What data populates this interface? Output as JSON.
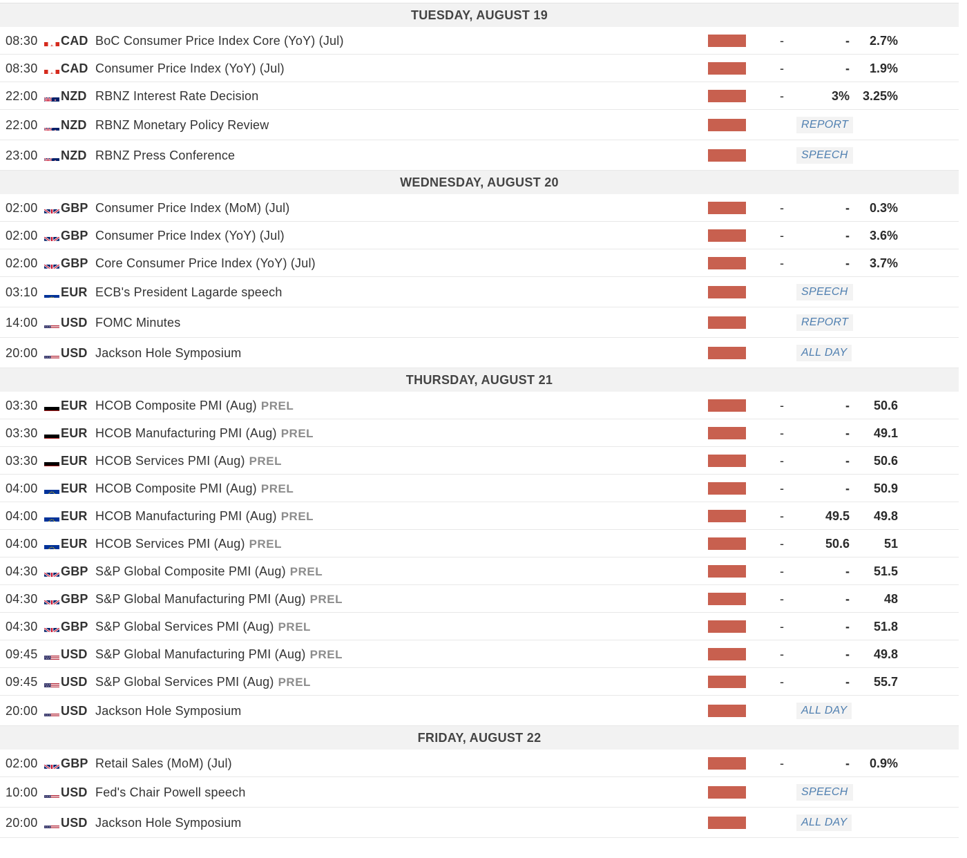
{
  "days": [
    {
      "label": "TUESDAY, AUGUST 19",
      "events": [
        {
          "time": "08:30",
          "flag": "ca",
          "currency": "CAD",
          "name": "BoC Consumer Price Index Core (YoY) (Jul)",
          "actual": "-",
          "consensus": "-",
          "previous": "2.7%"
        },
        {
          "time": "08:30",
          "flag": "ca",
          "currency": "CAD",
          "name": "Consumer Price Index (YoY) (Jul)",
          "actual": "-",
          "consensus": "-",
          "previous": "1.9%"
        },
        {
          "time": "22:00",
          "flag": "nz",
          "currency": "NZD",
          "name": "RBNZ Interest Rate Decision",
          "actual": "-",
          "consensus": "3%",
          "previous": "3.25%"
        },
        {
          "time": "22:00",
          "flag": "nz",
          "currency": "NZD",
          "name": "RBNZ Monetary Policy Review",
          "tag": "REPORT"
        },
        {
          "time": "23:00",
          "flag": "nz",
          "currency": "NZD",
          "name": "RBNZ Press Conference",
          "tag": "SPEECH"
        }
      ]
    },
    {
      "label": "WEDNESDAY, AUGUST 20",
      "events": [
        {
          "time": "02:00",
          "flag": "gb",
          "currency": "GBP",
          "name": "Consumer Price Index (MoM) (Jul)",
          "actual": "-",
          "consensus": "-",
          "previous": "0.3%"
        },
        {
          "time": "02:00",
          "flag": "gb",
          "currency": "GBP",
          "name": "Consumer Price Index (YoY) (Jul)",
          "actual": "-",
          "consensus": "-",
          "previous": "3.6%"
        },
        {
          "time": "02:00",
          "flag": "gb",
          "currency": "GBP",
          "name": "Core Consumer Price Index (YoY) (Jul)",
          "actual": "-",
          "consensus": "-",
          "previous": "3.7%"
        },
        {
          "time": "03:10",
          "flag": "eu",
          "currency": "EUR",
          "name": "ECB's President Lagarde speech",
          "tag": "SPEECH"
        },
        {
          "time": "14:00",
          "flag": "us",
          "currency": "USD",
          "name": "FOMC Minutes",
          "tag": "REPORT"
        },
        {
          "time": "20:00",
          "flag": "us",
          "currency": "USD",
          "name": "Jackson Hole Symposium",
          "tag": "ALL DAY"
        }
      ]
    },
    {
      "label": "THURSDAY, AUGUST 21",
      "events": [
        {
          "time": "03:30",
          "flag": "de",
          "currency": "EUR",
          "name": "HCOB Composite PMI (Aug)",
          "prel": "PREL",
          "actual": "-",
          "consensus": "-",
          "previous": "50.6"
        },
        {
          "time": "03:30",
          "flag": "de",
          "currency": "EUR",
          "name": "HCOB Manufacturing PMI (Aug)",
          "prel": "PREL",
          "actual": "-",
          "consensus": "-",
          "previous": "49.1"
        },
        {
          "time": "03:30",
          "flag": "de",
          "currency": "EUR",
          "name": "HCOB Services PMI (Aug)",
          "prel": "PREL",
          "actual": "-",
          "consensus": "-",
          "previous": "50.6"
        },
        {
          "time": "04:00",
          "flag": "eu",
          "currency": "EUR",
          "name": "HCOB Composite PMI (Aug)",
          "prel": "PREL",
          "actual": "-",
          "consensus": "-",
          "previous": "50.9"
        },
        {
          "time": "04:00",
          "flag": "eu",
          "currency": "EUR",
          "name": "HCOB Manufacturing PMI (Aug)",
          "prel": "PREL",
          "actual": "-",
          "consensus": "49.5",
          "previous": "49.8"
        },
        {
          "time": "04:00",
          "flag": "eu",
          "currency": "EUR",
          "name": "HCOB Services PMI (Aug)",
          "prel": "PREL",
          "actual": "-",
          "consensus": "50.6",
          "previous": "51"
        },
        {
          "time": "04:30",
          "flag": "gb",
          "currency": "GBP",
          "name": "S&P Global Composite PMI (Aug)",
          "prel": "PREL",
          "actual": "-",
          "consensus": "-",
          "previous": "51.5"
        },
        {
          "time": "04:30",
          "flag": "gb",
          "currency": "GBP",
          "name": "S&P Global Manufacturing PMI (Aug)",
          "prel": "PREL",
          "actual": "-",
          "consensus": "-",
          "previous": "48"
        },
        {
          "time": "04:30",
          "flag": "gb",
          "currency": "GBP",
          "name": "S&P Global Services PMI (Aug)",
          "prel": "PREL",
          "actual": "-",
          "consensus": "-",
          "previous": "51.8"
        },
        {
          "time": "09:45",
          "flag": "us",
          "currency": "USD",
          "name": "S&P Global Manufacturing PMI (Aug)",
          "prel": "PREL",
          "actual": "-",
          "consensus": "-",
          "previous": "49.8"
        },
        {
          "time": "09:45",
          "flag": "us",
          "currency": "USD",
          "name": "S&P Global Services PMI (Aug)",
          "prel": "PREL",
          "actual": "-",
          "consensus": "-",
          "previous": "55.7"
        },
        {
          "time": "20:00",
          "flag": "us",
          "currency": "USD",
          "name": "Jackson Hole Symposium",
          "tag": "ALL DAY"
        }
      ]
    },
    {
      "label": "FRIDAY, AUGUST 22",
      "events": [
        {
          "time": "02:00",
          "flag": "gb",
          "currency": "GBP",
          "name": "Retail Sales (MoM) (Jul)",
          "actual": "-",
          "consensus": "-",
          "previous": "0.9%"
        },
        {
          "time": "10:00",
          "flag": "us",
          "currency": "USD",
          "name": "Fed's Chair Powell speech",
          "tag": "SPEECH"
        },
        {
          "time": "20:00",
          "flag": "us",
          "currency": "USD",
          "name": "Jackson Hole Symposium",
          "tag": "ALL DAY"
        }
      ]
    }
  ],
  "colors": {
    "impact_high": "#c8604f",
    "tag_text": "#4f7fb0",
    "header_bg": "#f2f2f2"
  },
  "flag_icons": {
    "ca": "canada-flag-icon",
    "nz": "new-zealand-flag-icon",
    "gb": "uk-flag-icon",
    "eu": "eu-flag-icon",
    "de": "germany-flag-icon",
    "us": "usa-flag-icon"
  }
}
